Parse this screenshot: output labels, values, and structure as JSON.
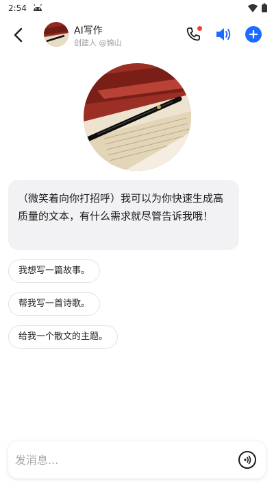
{
  "status_bar": {
    "time": "2:54"
  },
  "header": {
    "bot_name": "AI写作",
    "creator": "创建人 @锦山",
    "add_button_color": "#1f6bff",
    "call_badge_color": "#f23c3c",
    "speaker_color": "#1f6bff"
  },
  "chat": {
    "greeting": "（微笑着向你打招呼）我可以为你快速生成高质量的文本，有什么需求就尽管告诉我哦！",
    "suggestions": [
      "我想写一篇故事。",
      "帮我写一首诗歌。",
      "给我一个散文的主题。"
    ]
  },
  "input": {
    "placeholder": "发消息..."
  },
  "icons": {
    "back": "back-arrow-icon",
    "call": "phone-icon",
    "speaker": "speaker-icon",
    "add": "plus-icon",
    "voice": "voice-wave-icon"
  }
}
